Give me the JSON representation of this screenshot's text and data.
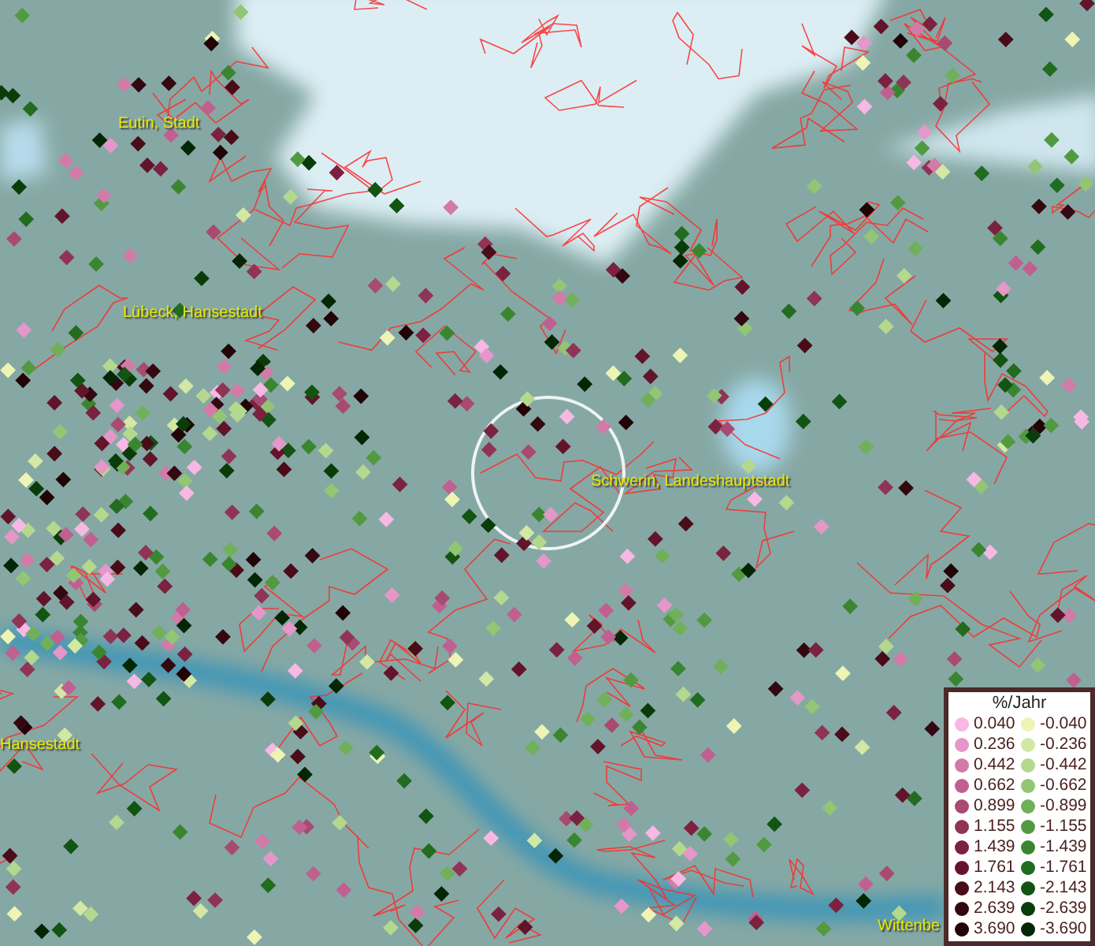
{
  "map": {
    "place_labels": [
      {
        "text": "Eutin, Stadt"
      },
      {
        "text": "Lübeck, Hansestadt"
      },
      {
        "text": "Schwerin, Landeshauptstadt"
      },
      {
        "text": "Hansestadt"
      },
      {
        "text": "Wittenbe"
      }
    ]
  },
  "legend": {
    "title": "%/Jahr",
    "items": [
      {
        "label": "0.040",
        "color": "#f7b8e4"
      },
      {
        "label": "-0.040",
        "color": "#eef5b4"
      },
      {
        "label": "0.236",
        "color": "#e497c8"
      },
      {
        "label": "-0.236",
        "color": "#d2e8a4"
      },
      {
        "label": "0.442",
        "color": "#d27aa8"
      },
      {
        "label": "-0.442",
        "color": "#b4d88e"
      },
      {
        "label": "0.662",
        "color": "#c06090"
      },
      {
        "label": "-0.662",
        "color": "#92c674"
      },
      {
        "label": "0.899",
        "color": "#a84a72"
      },
      {
        "label": "-0.899",
        "color": "#70b05a"
      },
      {
        "label": "1.155",
        "color": "#903456"
      },
      {
        "label": "-1.155",
        "color": "#529a40"
      },
      {
        "label": "1.439",
        "color": "#7a2240"
      },
      {
        "label": "-1.439",
        "color": "#3a8630"
      },
      {
        "label": "1.761",
        "color": "#62142a"
      },
      {
        "label": "-1.761",
        "color": "#226c20"
      },
      {
        "label": "2.143",
        "color": "#4a0c18"
      },
      {
        "label": "-2.143",
        "color": "#125412"
      },
      {
        "label": "2.639",
        "color": "#340810"
      },
      {
        "label": "-2.639",
        "color": "#0a3c0a"
      },
      {
        "label": "3.690",
        "color": "#220406"
      },
      {
        "label": "-3.690",
        "color": "#042604"
      }
    ]
  }
}
